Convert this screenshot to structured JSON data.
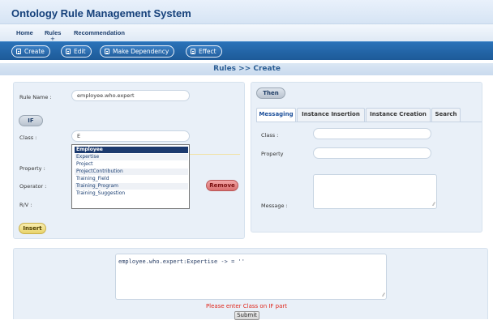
{
  "app": {
    "title": "Ontology Rule Management System"
  },
  "nav": {
    "items": [
      {
        "label": "Home"
      },
      {
        "label": "Rules"
      },
      {
        "label": "Recommendation"
      }
    ],
    "caret": "+"
  },
  "toolbar": {
    "create": "Create",
    "edit": "Edit",
    "make_dependency": "Make Dependency",
    "effect": "Effect"
  },
  "breadcrumb": "Rules >> Create",
  "left": {
    "rule_name_label": "Rule Name :",
    "rule_name_value": "employee.who.expert",
    "if_label": "IF",
    "class_label": "Class :",
    "class_value": "E",
    "property_label": "Property :",
    "operator_label": "Operator :",
    "rv_label": "R/V :",
    "remove_label": "Remove",
    "insert_label": "Insert",
    "class_suggestions": [
      "Employee",
      "Expertise",
      "Project",
      "ProjectContribution",
      "Training_Field",
      "Training_Program",
      "Training_Suggestion"
    ],
    "selected_suggestion": "Employee"
  },
  "right": {
    "then_label": "Then",
    "tabs": [
      {
        "label": "Messaging"
      },
      {
        "label": "Instance Insertion"
      },
      {
        "label": "Instance Creation"
      },
      {
        "label": "Search"
      }
    ],
    "active_tab": "Messaging",
    "class_label": "Class :",
    "class_value": "",
    "property_label": "Property",
    "property_value": "",
    "message_label": "Message :",
    "message_value": ""
  },
  "output": {
    "text": "employee.who.expert:Expertise  ->  = ''",
    "error": "Please enter Class on IF part",
    "submit": "Submit"
  }
}
